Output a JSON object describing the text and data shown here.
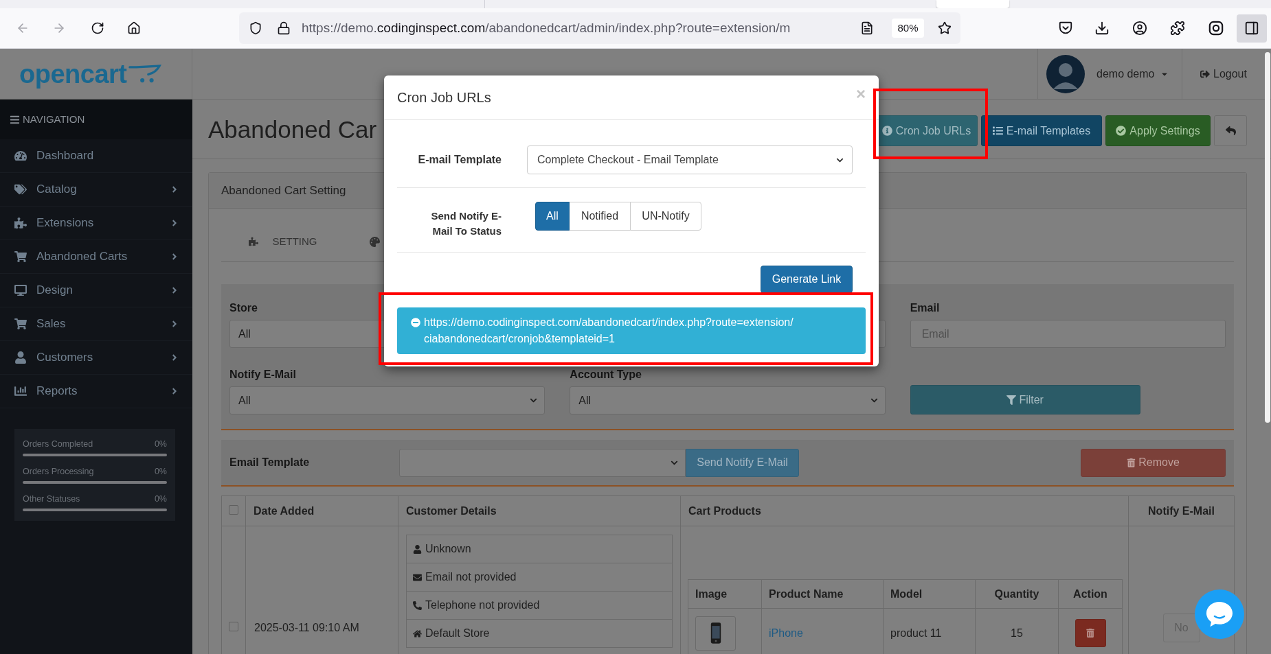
{
  "browser": {
    "url": {
      "scheme": "https://demo.",
      "domain": "codinginspect.com",
      "path": "/abandonedcart/admin/index.php?route=extension/m"
    },
    "zoom": "80%"
  },
  "header": {
    "logo": "opencart",
    "user": "demo demo",
    "logout": "Logout"
  },
  "sidebar": {
    "heading": "NAVIGATION",
    "items": [
      {
        "label": "Dashboard",
        "has_submenu": false
      },
      {
        "label": "Catalog",
        "has_submenu": true
      },
      {
        "label": "Extensions",
        "has_submenu": true
      },
      {
        "label": "Abandoned Carts",
        "has_submenu": true
      },
      {
        "label": "Design",
        "has_submenu": true
      },
      {
        "label": "Sales",
        "has_submenu": true
      },
      {
        "label": "Customers",
        "has_submenu": true
      },
      {
        "label": "Reports",
        "has_submenu": true
      }
    ],
    "stats": [
      {
        "label": "Orders Completed",
        "reading": "0%"
      },
      {
        "label": "Orders Processing",
        "reading": "0%"
      },
      {
        "label": "Other Statuses",
        "reading": "0%"
      }
    ]
  },
  "page": {
    "title": "Abandoned Car",
    "actions": [
      {
        "kind": "info",
        "label": "Cron Job URLs"
      },
      {
        "kind": "primary",
        "label": "E-mail Templates"
      },
      {
        "kind": "success",
        "label": "Apply Settings"
      },
      {
        "kind": "back"
      }
    ]
  },
  "panel": {
    "title": "Abandoned Cart Setting",
    "tabs": [
      {
        "label": "SETTING"
      }
    ]
  },
  "filters": {
    "store": {
      "label": "Store",
      "value": "All"
    },
    "email": {
      "label": "Email",
      "placeholder": "Email"
    },
    "notify_email": {
      "label": "Notify E-Mail",
      "value": "All"
    },
    "account_type": {
      "label": "Account Type",
      "value": "All"
    },
    "filter_button": "Filter"
  },
  "bulk_bar": {
    "label": "Email Template",
    "send_button": {
      "label": "Send Notify E-Mail",
      "disabled": true
    },
    "remove_button": {
      "label": "Remove",
      "disabled": true
    }
  },
  "table": {
    "select_all": {
      "checked": false
    },
    "columns": [
      "Date Added",
      "Customer Details",
      "Cart Products",
      "Notify E-Mail"
    ],
    "rows": [
      {
        "checked": false,
        "date_added": "2025-03-11 09:10 AM",
        "customer_details": [
          {
            "kind": "name",
            "text": "Unknown"
          },
          {
            "kind": "email",
            "text": "Email not provided"
          },
          {
            "kind": "phone",
            "text": "Telephone not provided"
          },
          {
            "kind": "store",
            "text": "Default Store"
          }
        ],
        "cart_products": {
          "columns": [
            "Image",
            "Product Name",
            "Model",
            "Quantity",
            "Action"
          ],
          "rows": [
            {
              "name": "iPhone",
              "model": "product 11",
              "quantity": "15"
            }
          ]
        },
        "notify_email": "No"
      }
    ]
  },
  "modal": {
    "title": "Cron Job URLs",
    "close": "×",
    "template": {
      "label": "E-mail Template",
      "value": "Complete Checkout - Email Template"
    },
    "status": {
      "label": "Send Notify E-Mail To Status",
      "options": [
        {
          "label": "All",
          "selected": true
        },
        {
          "label": "Notified",
          "selected": false
        },
        {
          "label": "UN-Notify",
          "selected": false
        }
      ]
    },
    "generate_button": "Generate Link",
    "link": "https://demo.codinginspect.com/abandonedcart/index.php?route=extension/ciabandonedcart/cronjob&templateid=1"
  }
}
